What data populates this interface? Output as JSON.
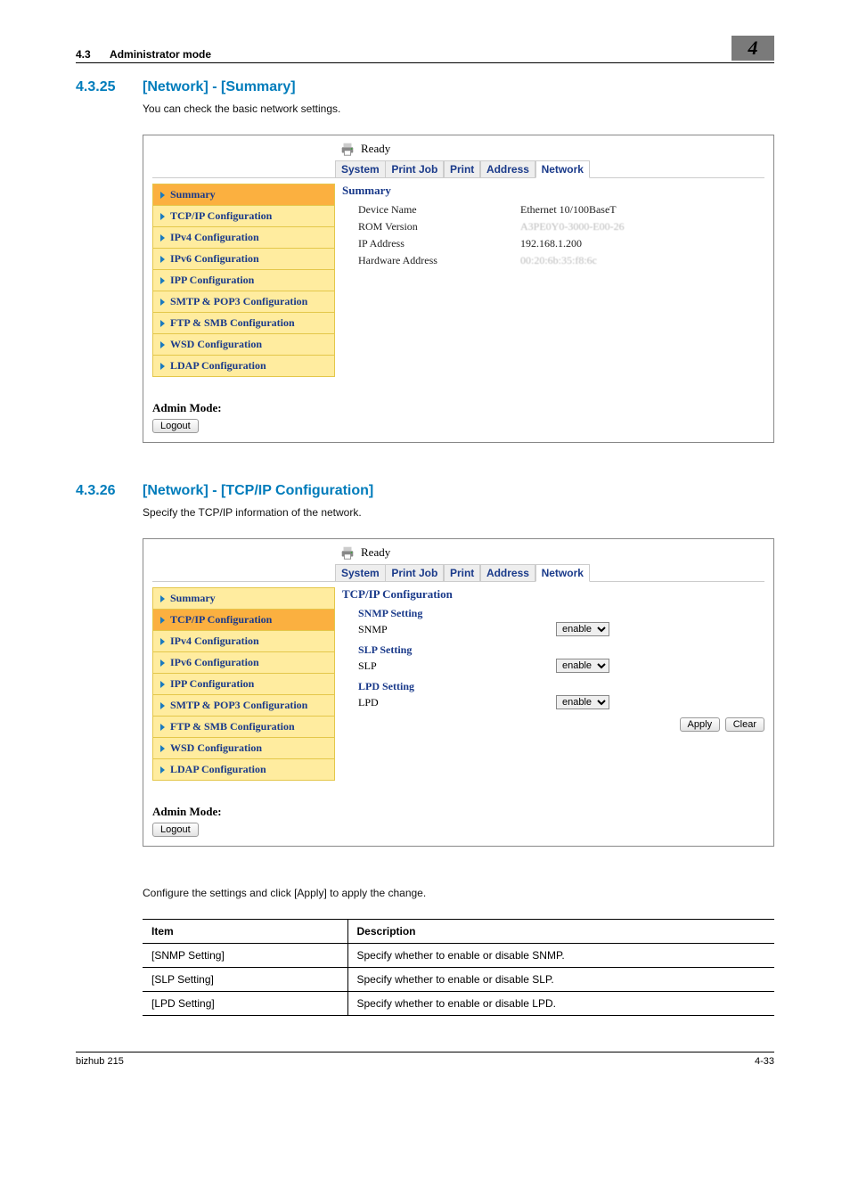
{
  "header": {
    "section_num": "4.3",
    "section_title": "Administrator mode",
    "chapter": "4"
  },
  "sec1": {
    "num": "4.3.25",
    "title": "[Network] - [Summary]",
    "intro": "You can check the basic network settings."
  },
  "shot1": {
    "status": "Ready",
    "tabs": {
      "system": "System",
      "printjob": "Print Job",
      "print": "Print",
      "address": "Address",
      "network": "Network"
    },
    "sidebar": {
      "summary": "Summary",
      "tcpip": "TCP/IP Configuration",
      "ipv4": "IPv4 Configuration",
      "ipv6": "IPv6 Configuration",
      "ipp": "IPP Configuration",
      "smtp": "SMTP & POP3 Configuration",
      "ftp": "FTP & SMB Configuration",
      "wsd": "WSD Configuration",
      "ldap": "LDAP Configuration"
    },
    "admin_mode_lbl": "Admin Mode:",
    "logout": "Logout",
    "content_title": "Summary",
    "rows": {
      "device_name_k": "Device Name",
      "device_name_v": "Ethernet 10/100BaseT",
      "rom_k": "ROM Version",
      "rom_v": "A3PE0Y0-3000-E00-26",
      "ip_k": "IP Address",
      "ip_v": "192.168.1.200",
      "hw_k": "Hardware Address",
      "hw_v": "00:20:6b:35:f8:6c"
    }
  },
  "sec2": {
    "num": "4.3.26",
    "title": "[Network] - [TCP/IP Configuration]",
    "intro": "Specify the TCP/IP information of the network."
  },
  "shot2": {
    "content_title": "TCP/IP Configuration",
    "snmp_setting": "SNMP Setting",
    "snmp_lbl": "SNMP",
    "slp_setting": "SLP Setting",
    "slp_lbl": "SLP",
    "lpd_setting": "LPD Setting",
    "lpd_lbl": "LPD",
    "option_enable": "enable",
    "apply": "Apply",
    "clear": "Clear"
  },
  "table": {
    "intro": "Configure the settings and click [Apply] to apply the change.",
    "h_item": "Item",
    "h_desc": "Description",
    "r1_item": "[SNMP Setting]",
    "r1_desc": "Specify whether to enable or disable SNMP.",
    "r2_item": "[SLP Setting]",
    "r2_desc": "Specify whether to enable or disable SLP.",
    "r3_item": "[LPD Setting]",
    "r3_desc": "Specify whether to enable or disable LPD."
  },
  "footer": {
    "left": "bizhub 215",
    "right": "4-33"
  }
}
